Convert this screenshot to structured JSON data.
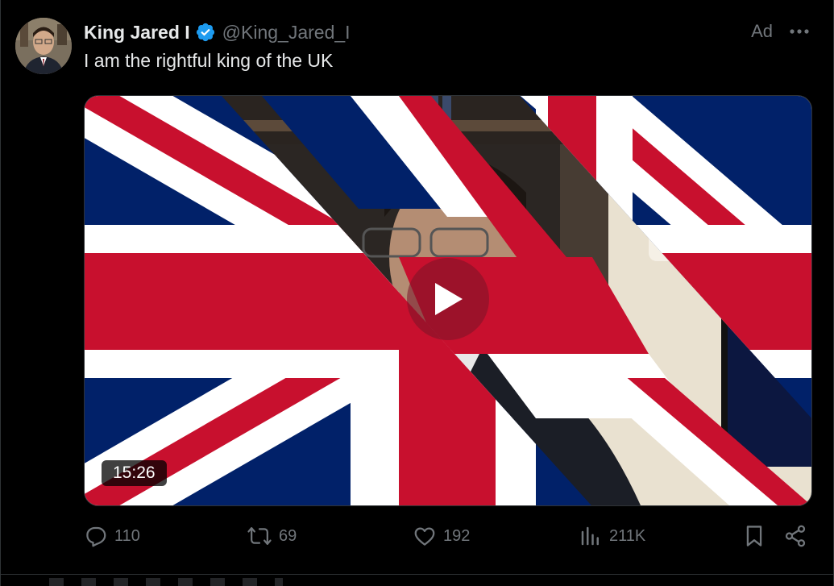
{
  "post": {
    "display_name": "King Jared I",
    "handle": "@King_Jared_I",
    "ad_label": "Ad",
    "text": "I am the rightful king of the UK",
    "verified": true
  },
  "media": {
    "type": "video",
    "duration": "15:26"
  },
  "actions": {
    "replies": "110",
    "reposts": "69",
    "likes": "192",
    "views": "211K"
  },
  "colors": {
    "background": "#000000",
    "text_primary": "#e7e9ea",
    "text_secondary": "#71767b",
    "verified_blue": "#1d9bf0",
    "flag_red": "#c8102e",
    "flag_blue": "#012169",
    "flag_white": "#ffffff"
  },
  "icons": {
    "verified": "verified-badge-icon",
    "more": "more-icon",
    "play": "play-icon",
    "reply": "reply-icon",
    "repost": "repost-icon",
    "like": "like-icon",
    "views": "views-icon",
    "bookmark": "bookmark-icon",
    "share": "share-icon"
  }
}
